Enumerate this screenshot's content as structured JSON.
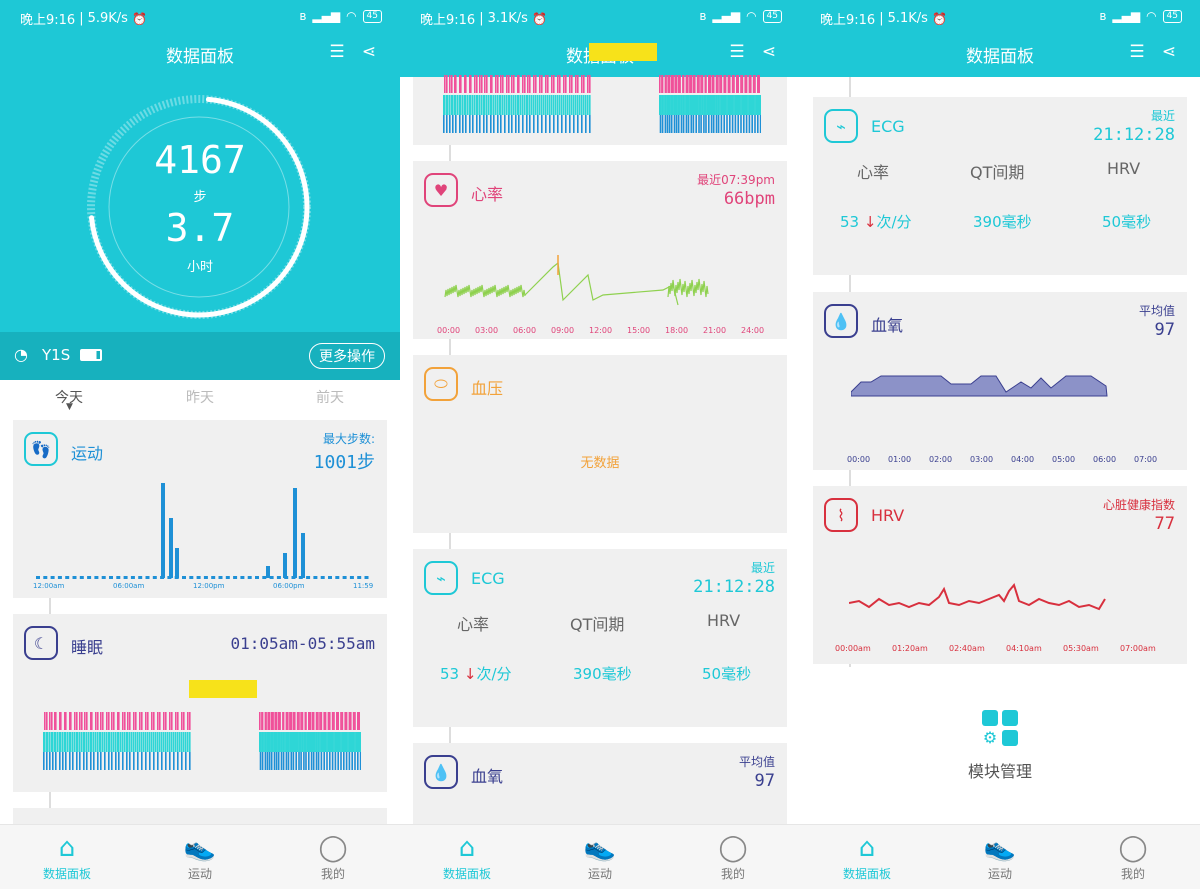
{
  "status": [
    {
      "time": "晚上9:16",
      "speed": "5.9K/s",
      "batt": "45"
    },
    {
      "time": "晚上9:16",
      "speed": "3.1K/s",
      "batt": "45"
    },
    {
      "time": "晚上9:16",
      "speed": "5.1K/s",
      "batt": "45"
    }
  ],
  "title": "数据面板",
  "nav": [
    "数据面板",
    "运动",
    "我的"
  ],
  "hero": {
    "steps": "4167",
    "steps_unit": "步",
    "hours": "3.7",
    "hours_unit": "小时",
    "progress": 0.72
  },
  "device": {
    "name": "Y1S",
    "more": "更多操作"
  },
  "days": [
    "今天",
    "昨天",
    "前天"
  ],
  "sport": {
    "title": "运动",
    "max_label": "最大步数:",
    "max_value": "1001步",
    "ticks": [
      "12:00am",
      "06:00am",
      "12:00pm",
      "06:00pm",
      "11:59pm"
    ]
  },
  "sleep": {
    "title": "睡眠",
    "range": "01:05am-05:55am"
  },
  "heart": {
    "title": "心率",
    "recent": "最近07:39pm",
    "value": "66bpm",
    "ticks": [
      "00:00",
      "03:00",
      "06:00",
      "09:00",
      "12:00",
      "15:00",
      "18:00",
      "21:00",
      "24:00"
    ]
  },
  "bp": {
    "title": "血压",
    "empty": "无数据"
  },
  "ecg": {
    "title": "ECG",
    "recent": "最近",
    "time": "21:12:28",
    "cols": [
      "心率",
      "QT间期",
      "HRV"
    ],
    "hr": "53",
    "hr_unit": "次/分",
    "arrow": "↓",
    "qt": "390毫秒",
    "hrv": "50毫秒"
  },
  "spo2": {
    "title": "血氧",
    "avg_label": "平均值",
    "avg": "97",
    "ticks": [
      "00:00",
      "01:00",
      "02:00",
      "03:00",
      "04:00",
      "05:00",
      "06:00",
      "07:00"
    ]
  },
  "hrv": {
    "title": "HRV",
    "label": "心脏健康指数",
    "value": "77",
    "ticks": [
      "00:00am",
      "01:20am",
      "02:40am",
      "04:10am",
      "05:30am",
      "07:00am"
    ]
  },
  "module": {
    "label": "模块管理"
  },
  "colors": {
    "accent": "#1ec8d6",
    "heart": "#e0447a",
    "bp": "#f2a23a",
    "navy": "#3a3f8f",
    "hrv": "#d8303e"
  }
}
